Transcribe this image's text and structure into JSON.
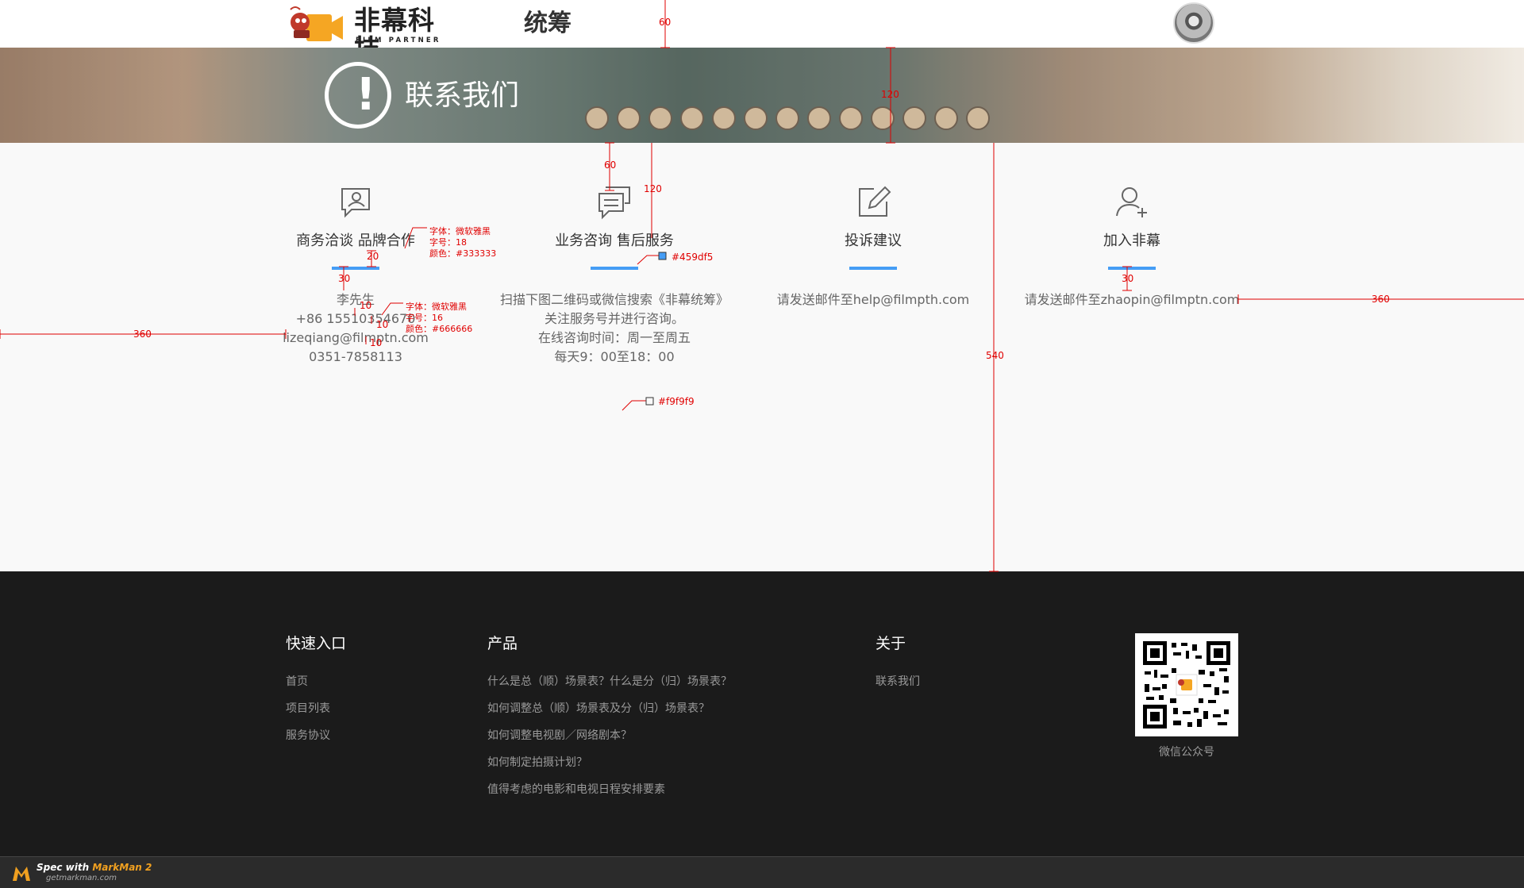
{
  "header": {
    "logo_cn": "非幕科技",
    "logo_en": "FILM PARTNER",
    "nav_label": "统筹"
  },
  "banner": {
    "title": "联系我们",
    "icon": "exclamation-circle-icon"
  },
  "cards": [
    {
      "icon": "business-chat-icon",
      "title": "商务洽谈 品牌合作",
      "lines": [
        "李先生",
        "+86  15510354670",
        "lizeqiang@filmptn.com",
        "0351-7858113"
      ]
    },
    {
      "icon": "chat-bubble-icon",
      "title": "业务咨询 售后服务",
      "lines": [
        "扫描下图二维码或微信搜索《非幕统筹》",
        "关注服务号并进行咨询。",
        "在线咨询时间：周一至周五",
        "每天9：00至18：00"
      ]
    },
    {
      "icon": "edit-icon",
      "title": "投诉建议",
      "lines": [
        "请发送邮件至help@filmpth.com"
      ]
    },
    {
      "icon": "add-user-icon",
      "title": "加入非幕",
      "lines": [
        "请发送邮件至zhaopin@filmptn.com"
      ]
    }
  ],
  "footer": {
    "quick": {
      "title": "快速入口",
      "links": [
        "首页",
        "项目列表",
        "服务协议"
      ]
    },
    "products": {
      "title": "产品",
      "links": [
        "什么是总（顺）场景表？什么是分（归）场景表？",
        "如何调整总（顺）场景表及分（归）场景表？",
        "如何调整电视剧／网络剧本？",
        "如何制定拍摄计划？",
        "值得考虑的电影和电视日程安排要素"
      ]
    },
    "about": {
      "title": "关于",
      "links": [
        "联系我们"
      ]
    },
    "qr_caption": "微信公众号"
  },
  "spec_bar": {
    "text_prefix": "Spec with",
    "text_brand": "MarkMan 2",
    "url": "getmarkman.com"
  },
  "annotations": {
    "header_height": "60",
    "banner_height": "120",
    "gap_banner_icon": "60",
    "gap_card": "120",
    "gap_bar": "20",
    "gap_text": "30",
    "gap_join": "30",
    "line_gap_1": "10",
    "line_gap_2": "10",
    "line_gap_3": "10",
    "side_left": "360",
    "side_right": "360",
    "content_height": "540",
    "title_font": "字体：微软雅黑",
    "title_size": "字号：18",
    "title_color": "颜色：#333333",
    "body_font": "字体：微软雅黑",
    "body_size": "字号：16",
    "body_color": "颜色：#666666",
    "accent_color": "#459df5",
    "bg_color": "#f9f9f9"
  },
  "colors": {
    "accent": "#459df5",
    "background": "#f9f9f9",
    "footer_bg": "#1b1b1b",
    "title_text": "#333333",
    "body_text": "#666666"
  }
}
